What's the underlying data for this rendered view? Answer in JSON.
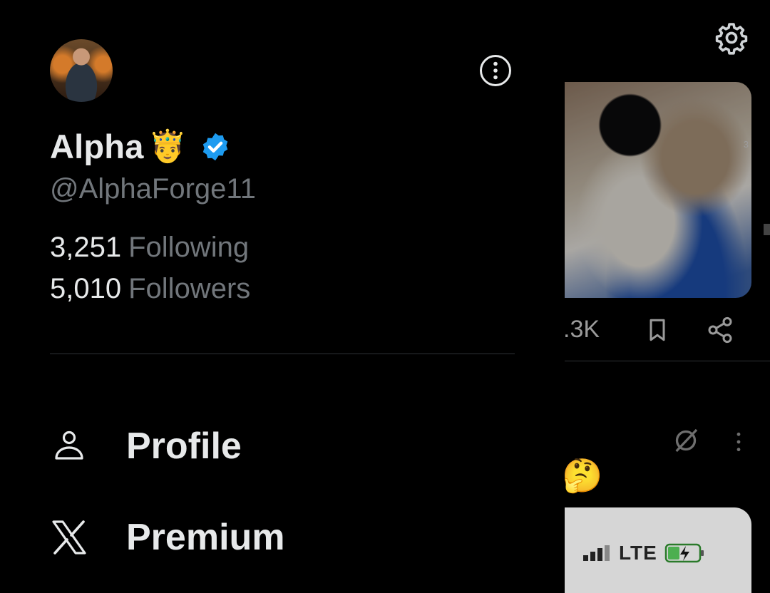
{
  "profile": {
    "display_name": "Alpha",
    "crown_emoji": "🤴",
    "handle": "@AlphaForge11",
    "verified": true,
    "following_count": "3,251",
    "following_label": "Following",
    "followers_count": "5,010",
    "followers_label": "Followers"
  },
  "nav": {
    "items": [
      {
        "label": "Profile",
        "icon": "person-icon"
      },
      {
        "label": "Premium",
        "icon": "x-logo-icon"
      }
    ]
  },
  "background": {
    "metric_text": ".3K",
    "media_count": "3",
    "reply_emoji": "🤔",
    "phone_status": "LTE"
  },
  "colors": {
    "background": "#000000",
    "primary_text": "#e7e9ea",
    "secondary_text": "#71767b",
    "verified_blue": "#1d9bf0",
    "divider": "#2f3336"
  }
}
